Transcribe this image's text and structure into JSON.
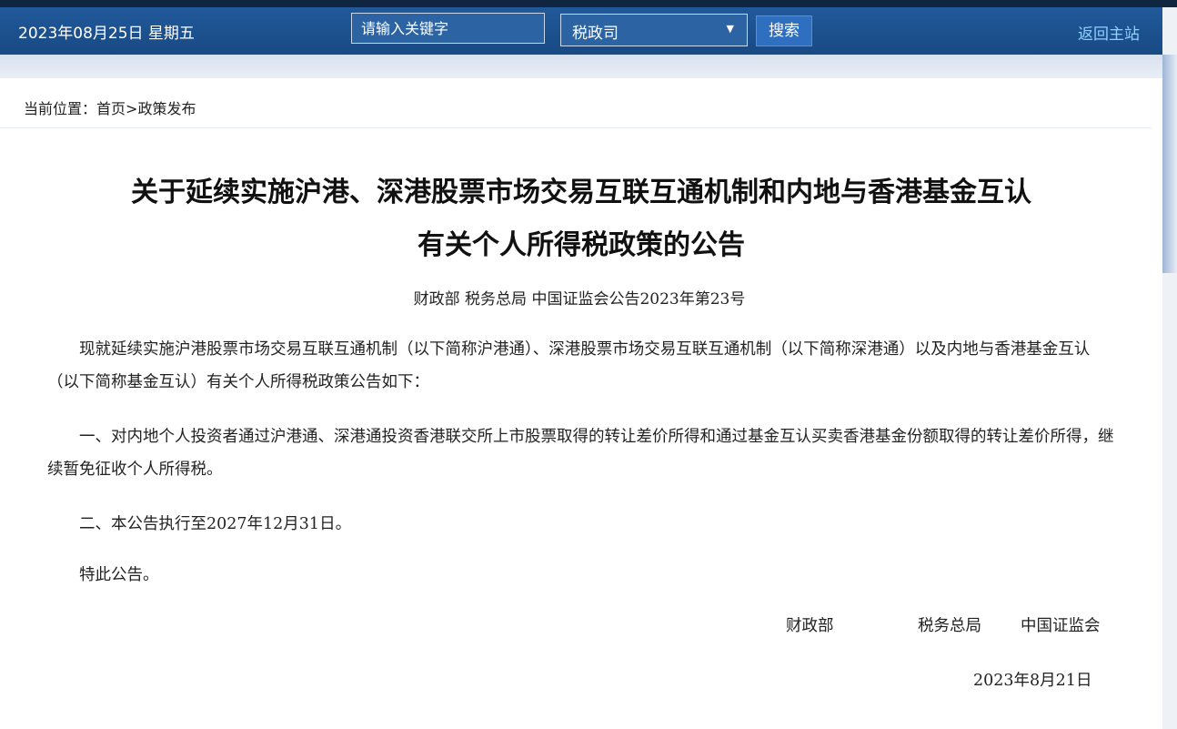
{
  "header": {
    "date": "2023年08月25日  星期五",
    "search_placeholder": "请输入关键字",
    "department": "税政司",
    "search_label": "搜索",
    "home_link": "返回主站"
  },
  "breadcrumb": {
    "prefix": "当前位置：",
    "home": "首页",
    "separator": ">",
    "current": "政策发布"
  },
  "article": {
    "title_line1": "关于延续实施沪港、深港股票市场交易互联互通机制和内地与香港基金互认",
    "title_line2": "有关个人所得税政策的公告",
    "doc_number": "财政部 税务总局 中国证监会公告2023年第23号",
    "paragraphs": [
      "现就延续实施沪港股票市场交易互联互通机制（以下简称沪港通）、深港股票市场交易互联互通机制（以下简称深港通）以及内地与香港基金互认（以下简称基金互认）有关个人所得税政策公告如下：",
      "一、对内地个人投资者通过沪港通、深港通投资香港联交所上市股票取得的转让差价所得和通过基金互认买卖香港基金份额取得的转让差价所得，继续暂免征收个人所得税。",
      "二、本公告执行至2027年12月31日。",
      "特此公告。"
    ],
    "signatories": [
      "财政部",
      "税务总局",
      "中国证监会"
    ],
    "sign_date": "2023年8月21日"
  }
}
